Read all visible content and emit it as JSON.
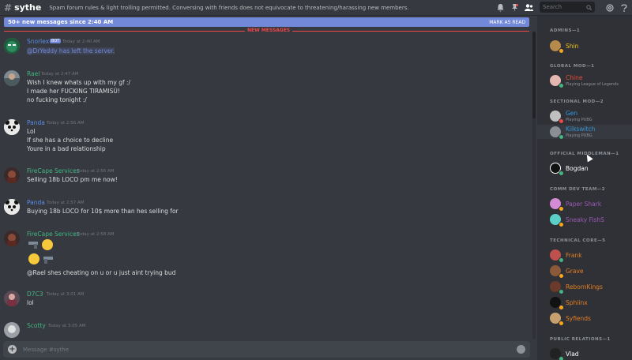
{
  "header": {
    "hash": "#",
    "channel": "sythe",
    "topic": "Spam forum rules & light trolling permitted. Conversing with friends does not equivocate to threatening/harassing new members.",
    "search_placeholder": "Search",
    "icons": [
      "bell-icon",
      "pin-icon",
      "members-icon",
      "search-icon",
      "at-icon",
      "help-icon"
    ]
  },
  "banner": {
    "text": "50+ new messages since 2:40 AM",
    "action": "MARK AS READ"
  },
  "new_messages_label": "NEW MESSAGES",
  "messages": [
    {
      "user": "Snorlex",
      "color": "#5b8ce6",
      "bot": "BOT",
      "ts": "Today at 2:40 AM",
      "lines": [
        "@DrYeddy has left the server."
      ]
    },
    {
      "user": "Rael",
      "color": "#43b581",
      "ts": "Today at 2:47 AM",
      "lines": [
        "Wish I knew whats up with my gf :/",
        "I made her FUCKING TIRAMISÚ!",
        "no fucking tonight :/"
      ]
    },
    {
      "user": "Panda",
      "color": "#5b8ce6",
      "ts": "Today at 2:56 AM",
      "lines": [
        "Lol",
        "If she has a choice to decline",
        "Youre in a bad relationship"
      ]
    },
    {
      "user": "FireCape Services",
      "color": "#43b581",
      "ts": "Today at 2:56 AM",
      "lines": [
        "Selling 18b LOCO pm me now!"
      ]
    },
    {
      "user": "Panda",
      "color": "#5b8ce6",
      "ts": "Today at 2:57 AM",
      "lines": [
        "Buying 18b LOCO for 10$ more than hes selling for"
      ]
    },
    {
      "user": "FireCape Services",
      "color": "#43b581",
      "ts": "Today at 2:58 AM",
      "lines": [
        "@Rael shes cheating on u or u just aint trying bud"
      ]
    },
    {
      "user": "D7C3",
      "color": "#43b581",
      "ts": "Today at 3:01 AM",
      "lines": [
        "lol"
      ]
    },
    {
      "user": "Scotty",
      "color": "#43b581",
      "ts": "Today at 3:05 AM",
      "lines": []
    }
  ],
  "input_placeholder": "Message #sythe",
  "members": {
    "roles": [
      {
        "name": "ADMINS—1"
      },
      {
        "name": "GLOBAL MOD—1"
      },
      {
        "name": "SECTIONAL MOD—2"
      },
      {
        "name": "OFFICIAL MIDDLEMAN—1"
      },
      {
        "name": "COMM DEV TEAM—2"
      },
      {
        "name": "TECHNICAL CORE—5"
      },
      {
        "name": "PUBLIC RELATIONS—1"
      }
    ],
    "list": [
      {
        "name": "Shin",
        "color": "#f1c40f",
        "status": "#faa61a"
      },
      {
        "name": "Chine",
        "color": "#e74c3c",
        "game": "Playing League of Legends",
        "status": "#43b581"
      },
      {
        "name": "Gen",
        "color": "#3498db",
        "game": "Playing PUBG",
        "status": "#f04747"
      },
      {
        "name": "Kilkswitch",
        "color": "#3498db",
        "game": "Playing PUBG",
        "status": "#43b581"
      },
      {
        "name": "Bogdan",
        "color": "#ffffff",
        "status": "#43b581"
      },
      {
        "name": "Paper Shark",
        "color": "#9b59b6",
        "status": "#faa61a"
      },
      {
        "name": "Sneaky FishS",
        "color": "#9b59b6",
        "status": "#faa61a"
      },
      {
        "name": "Frank",
        "color": "#e67e22",
        "status": "#43b581"
      },
      {
        "name": "Grave",
        "color": "#e67e22",
        "status": "#faa61a"
      },
      {
        "name": "RebornKings",
        "color": "#e67e22",
        "status": "#43b581"
      },
      {
        "name": "Sphiinx",
        "color": "#e67e22",
        "status": "#faa61a"
      },
      {
        "name": "Syfiends",
        "color": "#e67e22",
        "status": "#faa61a"
      },
      {
        "name": "Vlad",
        "color": "#ffffff",
        "status": "#43b581"
      }
    ]
  }
}
